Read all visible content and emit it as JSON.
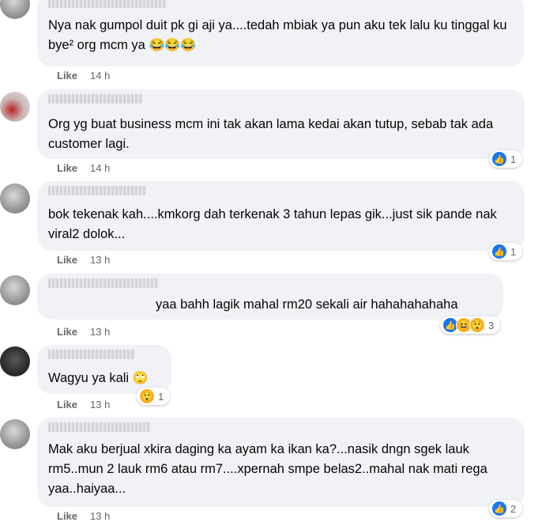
{
  "comments": [
    {
      "text": "Nya nak gumpol duit pk gi aji ya....tedah mbiak ya pun aku tek lalu ku tinggal ku bye² org mcm ya",
      "emoji": "😂😂😂",
      "like": "Like",
      "time": "14 h",
      "reactions": null
    },
    {
      "text": "Org yg buat business mcm ini tak akan lama kedai akan tutup, sebab tak ada customer lagi.",
      "emoji": "",
      "like": "Like",
      "time": "14 h",
      "reactions": {
        "icons": [
          "like"
        ],
        "count": "1"
      }
    },
    {
      "text": "bok tekenak kah....kmkorg dah terkenak 3 tahun lepas gik...just sik pande nak viral2 dolok...",
      "emoji": "",
      "like": "Like",
      "time": "13 h",
      "reactions": {
        "icons": [
          "like"
        ],
        "count": "1"
      }
    },
    {
      "text": "yaa bahh lagik mahal rm20 sekali air hahahahahaha",
      "emoji": "",
      "like": "Like",
      "time": "13 h",
      "reactions": {
        "icons": [
          "like",
          "haha",
          "wow"
        ],
        "count": "3"
      }
    },
    {
      "text": "Wagyu ya kali",
      "emoji": "🙄",
      "like": "Like",
      "time": "13 h",
      "reactions": {
        "icons": [
          "wow"
        ],
        "count": "1"
      }
    },
    {
      "text": "Mak aku berjual xkira daging ka ayam ka ikan ka?...nasik dngn sgek lauk rm5..mun 2 lauk rm6 atau rm7....xpernah smpe belas2..mahal nak mati rega yaa..haiyaa...",
      "emoji": "",
      "like": "Like",
      "time": "13 h",
      "reactions": {
        "icons": [
          "like"
        ],
        "count": "2"
      }
    }
  ],
  "colors": {
    "bubble": "#f0f2f5",
    "meta": "#65676b",
    "like_blue": "#1877f2",
    "haha_yellow": "#f7b125"
  }
}
